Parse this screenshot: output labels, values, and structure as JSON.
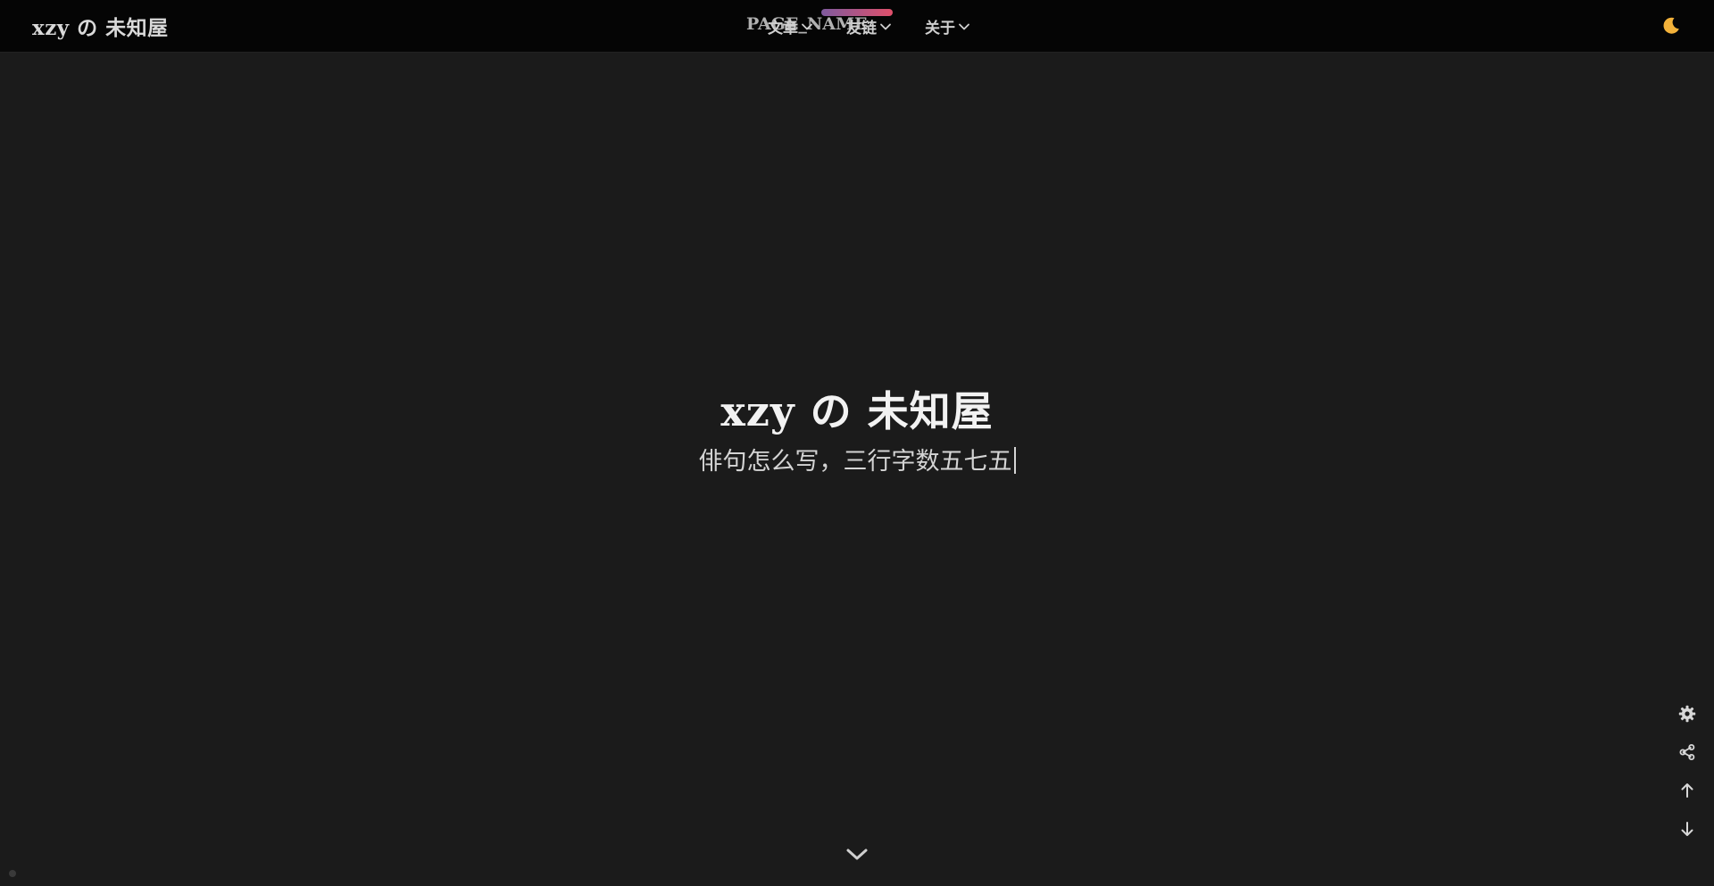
{
  "header": {
    "brand": "xzy の 未知屋",
    "page_name": "PAGE_NAME",
    "nav": [
      {
        "label": "文章"
      },
      {
        "label": "友链"
      },
      {
        "label": "关于"
      }
    ],
    "theme_icon": "moon-icon"
  },
  "hero": {
    "title": "xzy の 未知屋",
    "subtitle": "俳句怎么写，三行字数五七五"
  },
  "side_tools": [
    {
      "icon": "gear-icon"
    },
    {
      "icon": "share-icon"
    },
    {
      "icon": "arrow-up-icon"
    },
    {
      "icon": "arrow-down-icon"
    }
  ],
  "colors": {
    "background": "#1b1b1b",
    "topbar": "#050505",
    "moon": "#f3b23a",
    "progress_start": "#7f5a9e",
    "progress_end": "#e0506b"
  }
}
